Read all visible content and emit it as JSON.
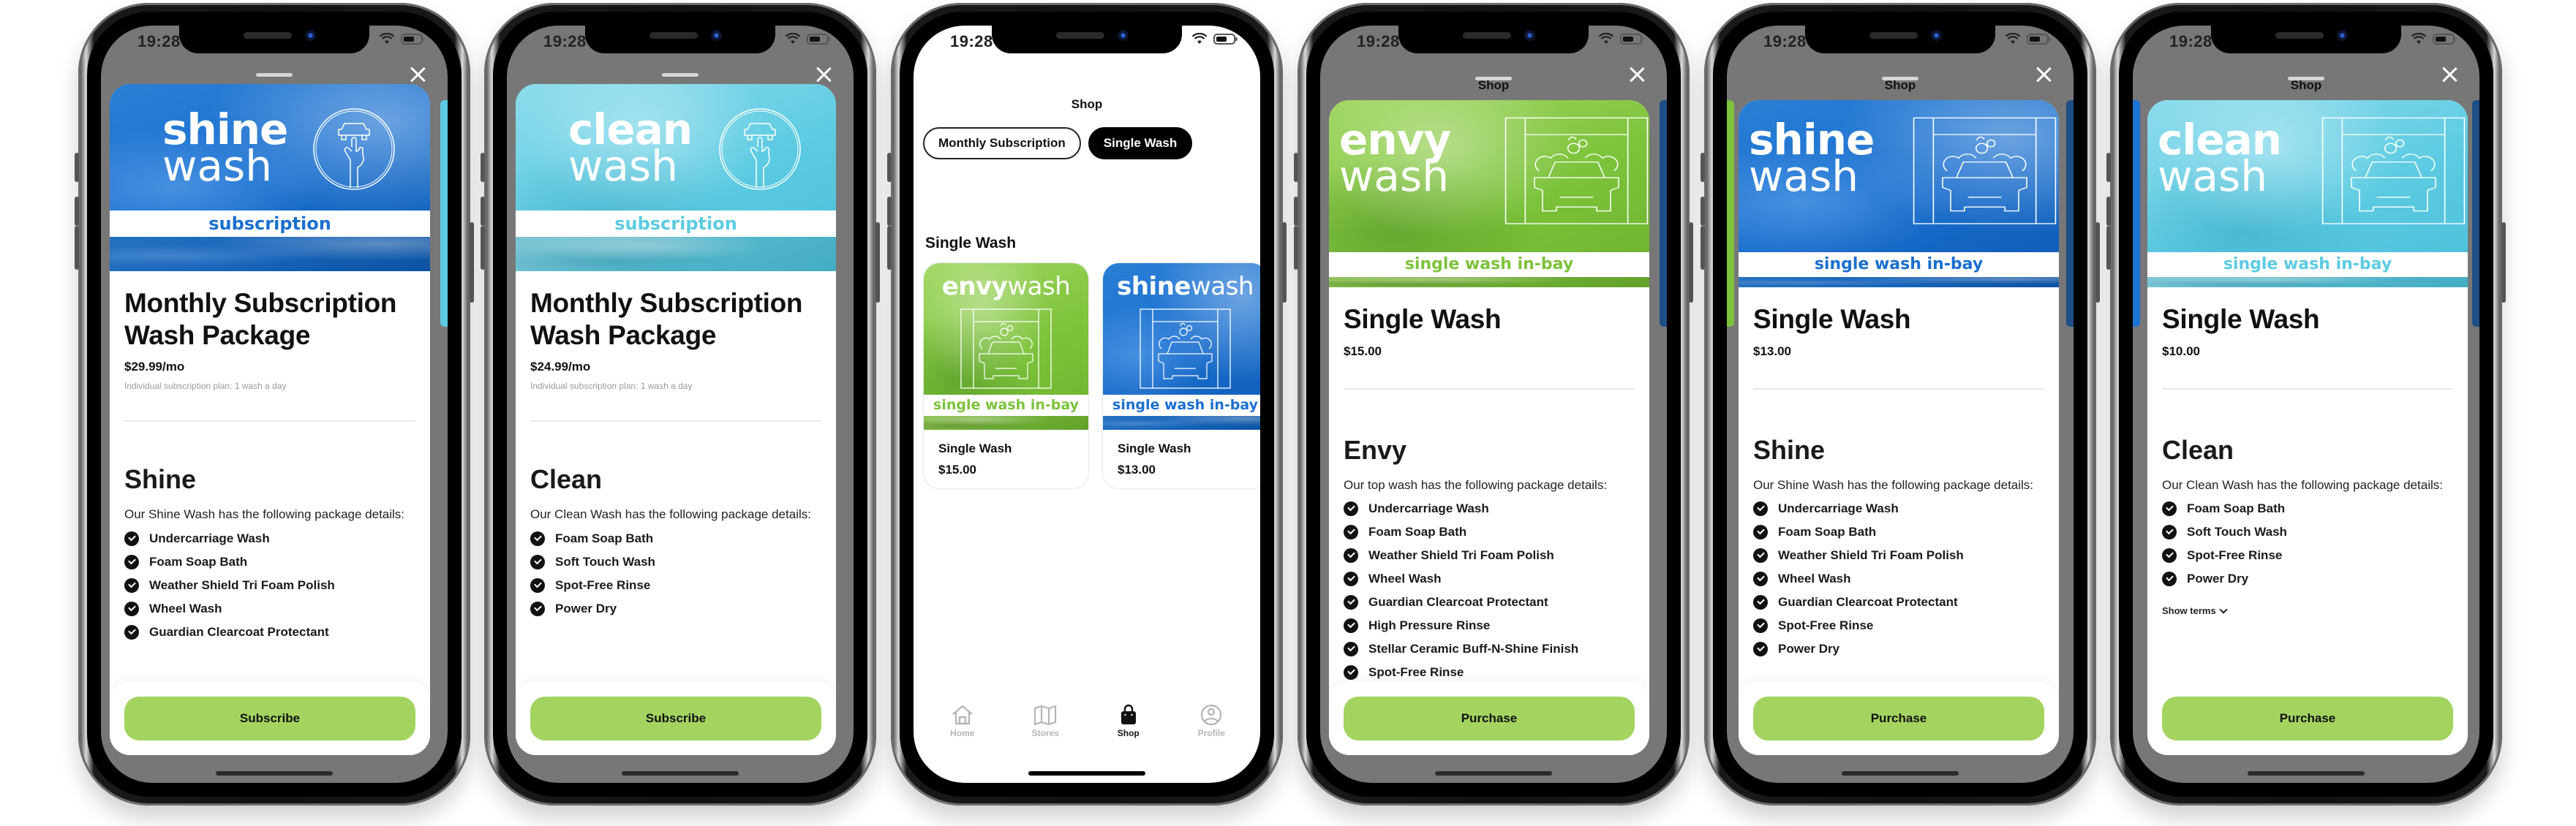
{
  "status_bar": {
    "time": "19:28"
  },
  "colors": {
    "overlay": "#777777",
    "cta": "#a3d45f",
    "shine_blue": "#1a74d2",
    "clean_cyan": "#5ccbe2",
    "envy_green": "#7cc23a"
  },
  "screens": [
    {
      "type": "subscription-detail",
      "brand": {
        "bold": "shine",
        "light": "wash",
        "strip": "subscription",
        "theme": "shine"
      },
      "title_line1": "Monthly Subscription",
      "title_line2": "Wash Package",
      "price": "$29.99/mo",
      "subtext": "Individual subscription plan: 1 wash a day",
      "package_name": "Shine",
      "package_desc": "Our Shine Wash has the following package details:",
      "features": [
        "Undercarriage Wash",
        "Foam Soap Bath",
        "Weather Shield Tri Foam Polish",
        "Wheel Wash",
        "Guardian Clearcoat Protectant"
      ],
      "cta_label": "Subscribe"
    },
    {
      "type": "subscription-detail",
      "brand": {
        "bold": "clean",
        "light": "wash",
        "strip": "subscription",
        "theme": "clean"
      },
      "title_line1": "Monthly Subscription",
      "title_line2": "Wash Package",
      "price": "$24.99/mo",
      "subtext": "Individual subscription plan: 1 wash a day",
      "package_name": "Clean",
      "package_desc": "Our Clean Wash has the following package details:",
      "features": [
        "Foam Soap Bath",
        "Soft Touch Wash",
        "Spot-Free Rinse",
        "Power Dry"
      ],
      "cta_label": "Subscribe"
    },
    {
      "type": "shop",
      "title": "Shop",
      "segments": [
        {
          "label": "Monthly Subscription",
          "selected": false
        },
        {
          "label": "Single Wash",
          "selected": true
        }
      ],
      "section_title": "Single Wash",
      "products": [
        {
          "brand_bold": "envy",
          "brand_light": "wash",
          "strip": "single wash in-bay",
          "theme": "envy",
          "name": "Single Wash",
          "price": "$15.00"
        },
        {
          "brand_bold": "shine",
          "brand_light": "wash",
          "strip": "single wash in-bay",
          "theme": "shine",
          "name": "Single Wash",
          "price": "$13.00"
        }
      ],
      "tabs": [
        {
          "label": "Home",
          "icon": "home-icon",
          "active": false
        },
        {
          "label": "Stores",
          "icon": "map-icon",
          "active": false
        },
        {
          "label": "Shop",
          "icon": "shopping-bag-icon",
          "active": true
        },
        {
          "label": "Profile",
          "icon": "profile-icon",
          "active": false
        }
      ]
    },
    {
      "type": "single-detail",
      "peek_title": "Shop",
      "brand": {
        "bold": "envy",
        "light": "wash",
        "strip": "single wash in-bay",
        "theme": "envy"
      },
      "title": "Single Wash",
      "price": "$15.00",
      "package_name": "Envy",
      "package_desc": "Our top wash has the following package details:",
      "features": [
        "Undercarriage Wash",
        "Foam Soap Bath",
        "Weather Shield Tri Foam Polish",
        "Wheel Wash",
        "Guardian Clearcoat Protectant",
        "High Pressure Rinse",
        "Stellar Ceramic Buff-N-Shine Finish",
        "Spot-Free Rinse"
      ],
      "cta_label": "Purchase"
    },
    {
      "type": "single-detail",
      "peek_title": "Shop",
      "brand": {
        "bold": "shine",
        "light": "wash",
        "strip": "single wash in-bay",
        "theme": "shine"
      },
      "title": "Single Wash",
      "price": "$13.00",
      "package_name": "Shine",
      "package_desc": "Our Shine Wash has the following package details:",
      "features": [
        "Undercarriage Wash",
        "Foam Soap Bath",
        "Weather Shield Tri Foam Polish",
        "Wheel Wash",
        "Guardian Clearcoat Protectant",
        "Spot-Free Rinse",
        "Power Dry"
      ],
      "cta_label": "Purchase"
    },
    {
      "type": "single-detail",
      "peek_title": "Shop",
      "brand": {
        "bold": "clean",
        "light": "wash",
        "strip": "single wash in-bay",
        "theme": "clean"
      },
      "title": "Single Wash",
      "price": "$10.00",
      "package_name": "Clean",
      "package_desc": "Our Clean Wash has the following package details:",
      "features": [
        "Foam Soap Bath",
        "Soft Touch Wash",
        "Spot-Free Rinse",
        "Power Dry"
      ],
      "show_terms_label": "Show terms",
      "cta_label": "Purchase"
    }
  ]
}
